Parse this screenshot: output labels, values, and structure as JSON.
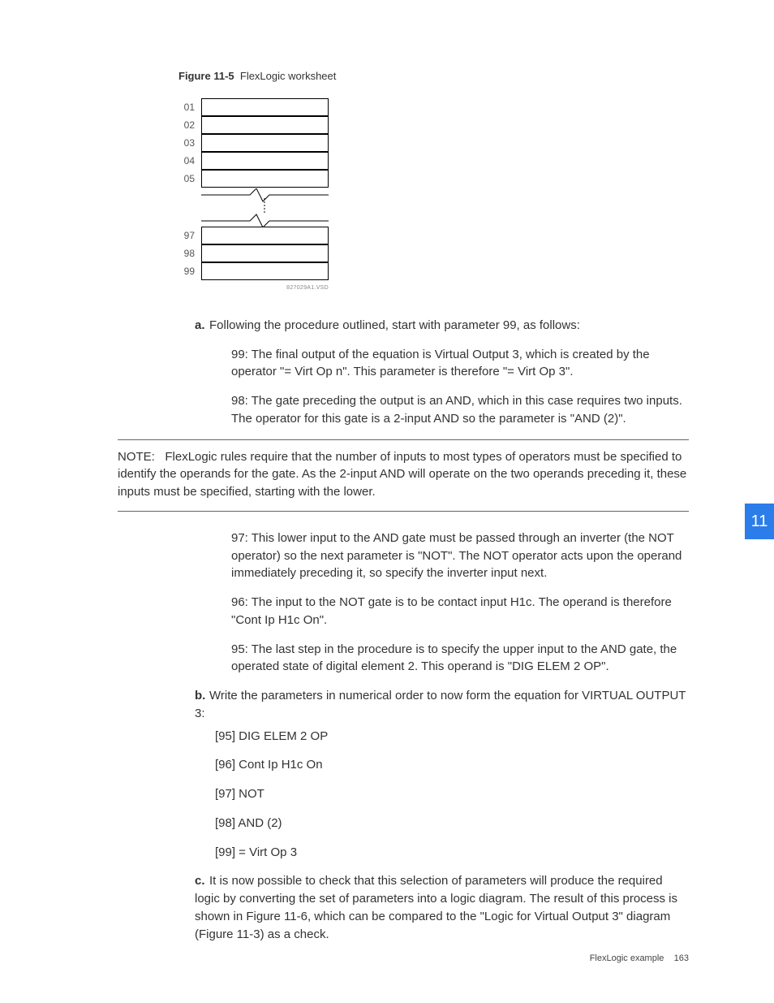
{
  "figure": {
    "label": "Figure 11-5",
    "title": "FlexLogic worksheet"
  },
  "worksheet": {
    "top_rows": [
      "01",
      "02",
      "03",
      "04",
      "05"
    ],
    "bottom_rows": [
      "97",
      "98",
      "99"
    ],
    "footer_label": "827029A1.VSD"
  },
  "step_a": {
    "letter": "a.",
    "intro": "Following the procedure outlined, start with parameter 99, as follows:",
    "p99": "99: The final output of the equation is Virtual Output 3, which is created by the operator \"= Virt Op n\". This parameter is therefore \"= Virt Op 3\".",
    "p98": "98: The gate preceding the output is an AND, which in this case requires two inputs. The operator for this gate is a 2-input AND so the parameter is \"AND (2)\"."
  },
  "note": {
    "label": "NOTE:",
    "text": "FlexLogic rules require that the number of inputs to most types of operators must be specified to identify the operands for the gate. As the 2-input AND will operate on the two operands preceding it, these inputs must be specified, starting with the lower."
  },
  "post_note": {
    "p97": "97: This lower input to the AND gate must be passed through an inverter (the NOT operator) so the next parameter is \"NOT\". The NOT operator acts upon the operand immediately preceding it, so specify the inverter input next.",
    "p96": "96: The input to the NOT gate is to be contact input H1c. The operand is therefore \"Cont Ip H1c On\".",
    "p95": "95: The last step in the procedure is to specify the upper input to the AND gate, the operated state of digital element 2. This operand is \"DIG ELEM 2 OP\"."
  },
  "step_b": {
    "letter": "b.",
    "intro": "Write the parameters in numerical order to now form the equation for VIRTUAL OUTPUT 3:",
    "lines": [
      "[95] DIG ELEM 2 OP",
      "[96] Cont Ip H1c On",
      "[97] NOT",
      "[98] AND (2)",
      "[99] = Virt Op 3"
    ]
  },
  "step_c": {
    "letter": "c.",
    "text": "It is now possible to check that this selection of parameters will produce the required logic by converting the set of parameters into a logic diagram. The result of this process is shown in Figure 11-6, which can be compared to the \"Logic for Virtual Output 3\" diagram (Figure 11-3) as a check."
  },
  "tab": "11",
  "footer": {
    "section": "FlexLogic example",
    "page": "163"
  }
}
